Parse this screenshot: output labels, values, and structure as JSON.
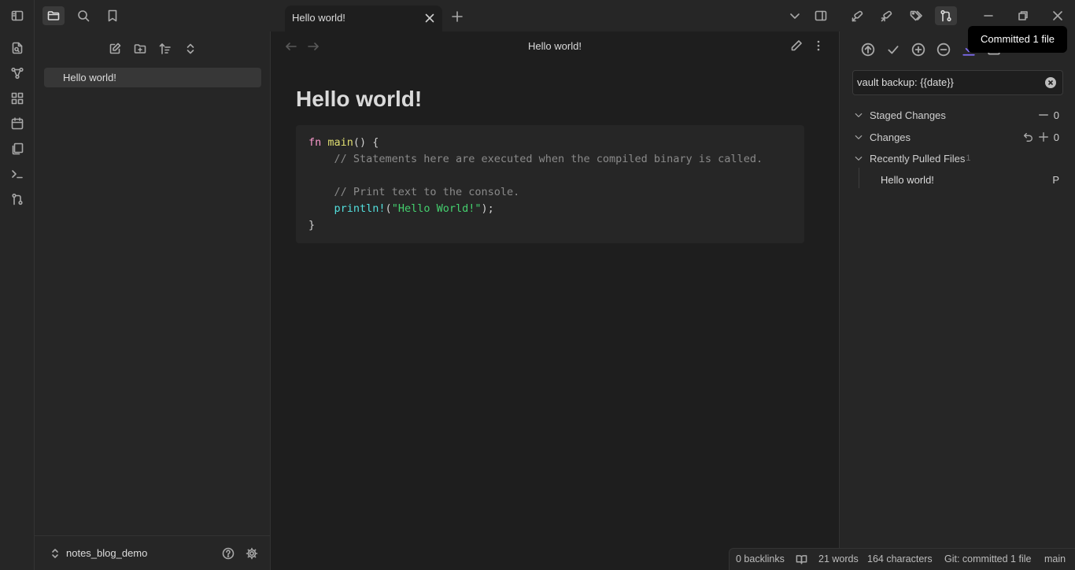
{
  "tab": {
    "title": "Hello world!"
  },
  "explorer": {
    "files": [
      "Hello world!"
    ],
    "vault_name": "notes_blog_demo"
  },
  "editor": {
    "view_title": "Hello world!",
    "heading": "Hello world!",
    "code": {
      "l1_kw": "fn",
      "l1_fn": "main",
      "l1_rest": "() {",
      "l2": "// Statements here are executed when the compiled binary is called.",
      "l4": "// Print text to the console.",
      "l5_macro": "println!",
      "l5_open": "(",
      "l5_str": "\"Hello World!\"",
      "l5_close": ");",
      "l6": "}"
    }
  },
  "git_panel": {
    "commit_message": "vault backup: {{date}}",
    "staged_label": "Staged Changes",
    "staged_count": "0",
    "changes_label": "Changes",
    "changes_count": "0",
    "pulled_label": "Recently Pulled Files",
    "pulled_count": "1",
    "pulled_file": "Hello world!",
    "pulled_status": "P"
  },
  "tooltip": "Committed 1 file",
  "statusbar": {
    "backlinks": "0 backlinks",
    "words": "21 words",
    "characters": "164 characters",
    "git_status": "Git: committed 1 file",
    "branch": "main"
  },
  "colors": {
    "accent": "#7f6df2",
    "keyword": "#fa99cd",
    "function": "#e0de71",
    "comment": "#8a8a8a",
    "string": "#44cf6e",
    "macro": "#53dfdd"
  }
}
